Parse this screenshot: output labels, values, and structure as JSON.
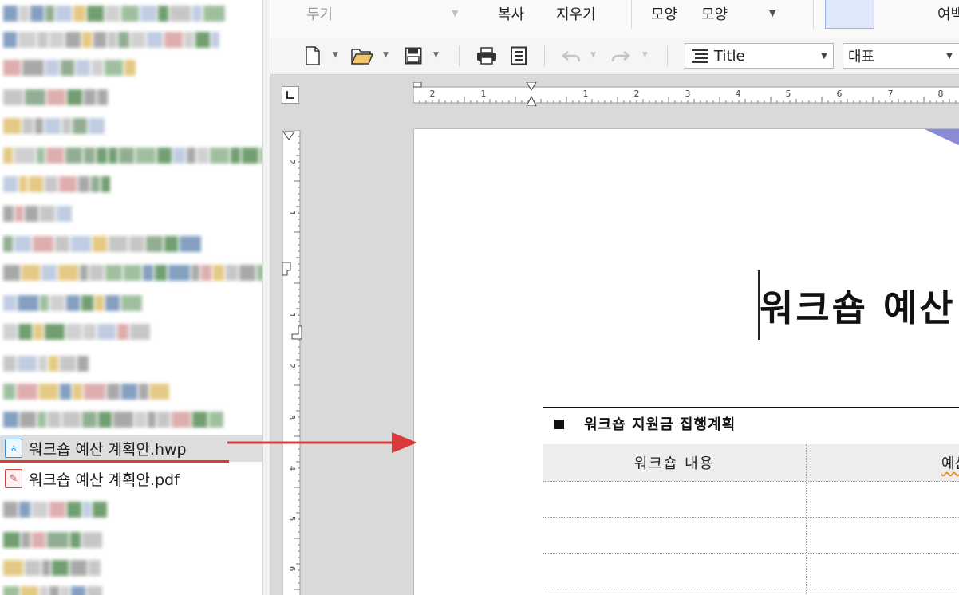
{
  "file_list": {
    "selected_file": "워크숍 예산 계획안.hwp",
    "other_file": "워크숍 예산 계획안.pdf"
  },
  "ribbon": {
    "items": [
      "두기",
      "복사",
      "지우기",
      "모양",
      "모양",
      "여백"
    ]
  },
  "toolbar": {
    "style_combo": "Title",
    "font_combo": "대표"
  },
  "rulers": {
    "horizontal_ticks": [
      "2",
      "1",
      "1",
      "2",
      "3",
      "4",
      "5",
      "6",
      "7",
      "8"
    ],
    "vertical_ticks": [
      "2",
      "1",
      "1",
      "2",
      "3",
      "4",
      "5",
      "6"
    ]
  },
  "document": {
    "title": "워크숍 예산",
    "section_title": "워크숍 지원금 집행계획",
    "table_headers": [
      "워크숍 내용",
      "예산"
    ]
  },
  "colors": {
    "annotation_red": "#d93b3b",
    "selection_bg": "#dedede",
    "hwp_icon_blue": "#3b8fd6",
    "pdf_icon_red": "#d64545"
  }
}
